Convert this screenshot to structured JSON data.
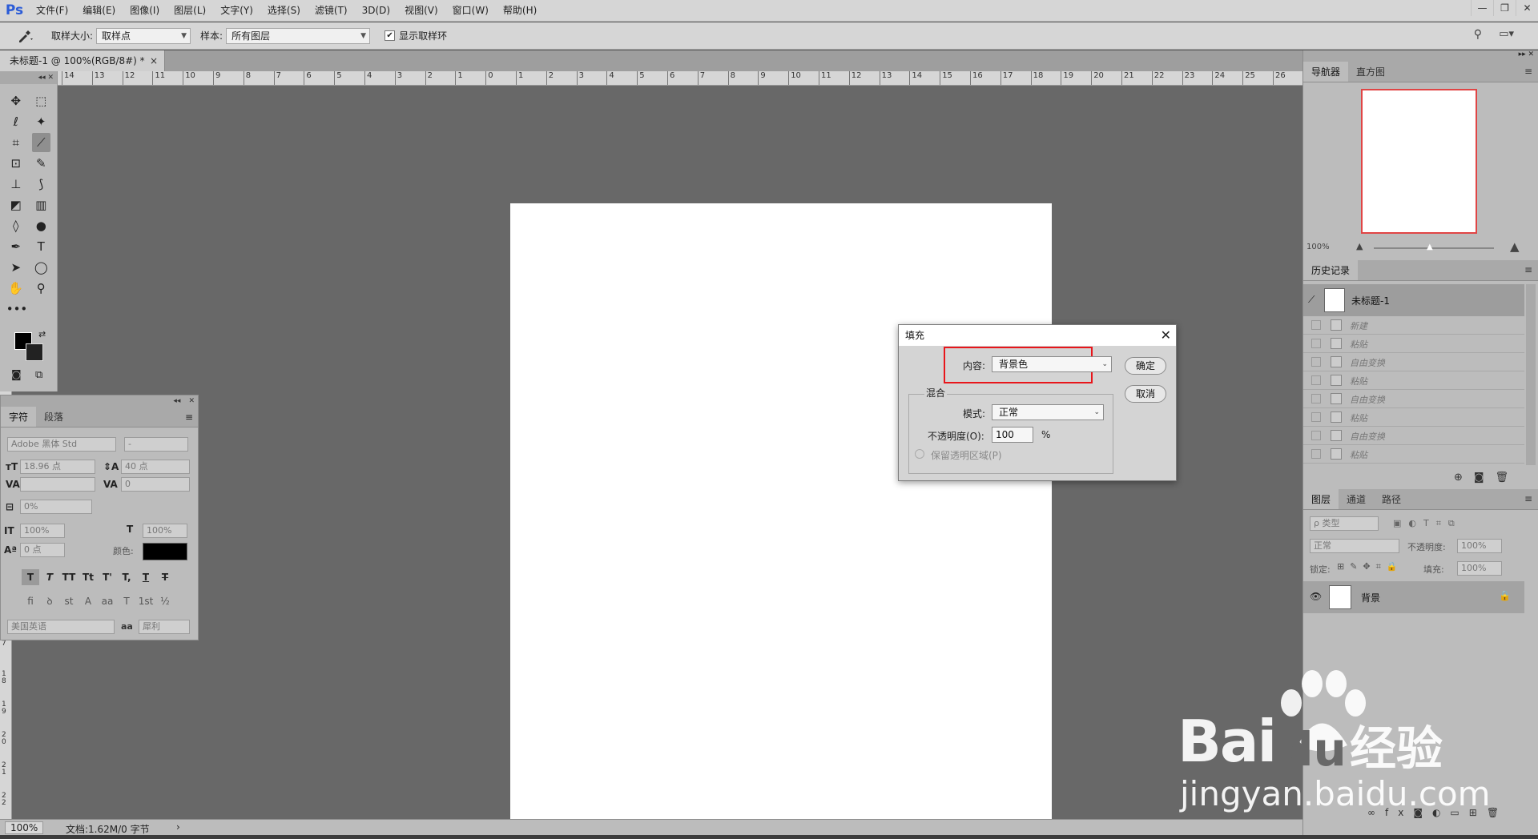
{
  "app": {
    "logo": "Ps",
    "menu": [
      "文件(F)",
      "编辑(E)",
      "图像(I)",
      "图层(L)",
      "文字(Y)",
      "选择(S)",
      "滤镜(T)",
      "3D(D)",
      "视图(V)",
      "窗口(W)",
      "帮助(H)"
    ],
    "window_controls": [
      "—",
      "❐",
      "✕"
    ]
  },
  "options_bar": {
    "sample_size_label": "取样大小:",
    "sample_size_value": "取样点",
    "sample_label": "样本:",
    "sample_value": "所有图层",
    "show_ring_label": "显示取样环",
    "show_ring_checked": true
  },
  "document_tab": {
    "title": "未标题-1 @ 100%(RGB/8#) *",
    "close": "×"
  },
  "ruler": {
    "h_ticks": [
      "14",
      "13",
      "12",
      "11",
      "10",
      "9",
      "8",
      "7",
      "6",
      "5",
      "4",
      "3",
      "2",
      "1",
      "0",
      "1",
      "2",
      "3",
      "4",
      "5",
      "6",
      "7",
      "8",
      "9",
      "10",
      "11",
      "12",
      "13",
      "14",
      "15",
      "16",
      "17",
      "18",
      "19",
      "20",
      "21",
      "22",
      "23",
      "24",
      "25",
      "26"
    ],
    "v_ticks": [
      "7",
      "1 8",
      "1 9",
      "2 0",
      "2 1",
      "2 2"
    ]
  },
  "character_panel": {
    "tabs": [
      "字符",
      "段落"
    ],
    "font_family": "Adobe 黑体 Std",
    "font_style": "-",
    "font_size": "18.96 点",
    "leading": "40 点",
    "kerning": "",
    "tracking": "0",
    "scale_pct": "0%",
    "vertical_scale": "100%",
    "horizontal_scale": "100%",
    "baseline_shift": "0 点",
    "color_label": "颜色:",
    "language": "美国英语",
    "aa_label": "aa",
    "antialias": "犀利",
    "style_buttons": [
      "T",
      "T",
      "TT",
      "Tt",
      "T'",
      "T,",
      "T",
      "T"
    ],
    "opentype_buttons": [
      "fi",
      "ꝺ",
      "st",
      "A",
      "aa",
      "T",
      "1st",
      "½"
    ]
  },
  "navigator": {
    "tabs": [
      "导航器",
      "直方图"
    ],
    "zoom": "100%"
  },
  "history": {
    "tab": "历史记录",
    "snapshot_label": "未标题-1",
    "items": [
      "新建",
      "粘贴",
      "自由变换",
      "粘贴",
      "自由变换",
      "粘贴",
      "自由变换",
      "粘贴"
    ]
  },
  "layers": {
    "tabs": [
      "图层",
      "通道",
      "路径"
    ],
    "filter_label": "ρ 类型",
    "blend_mode": "正常",
    "opacity_label": "不透明度:",
    "opacity_value": "100%",
    "lock_label": "锁定:",
    "fill_label": "填充:",
    "fill_value": "100%",
    "layer_name": "背景"
  },
  "status": {
    "zoom": "100%",
    "doc_info": "文档:1.62M/0 字节"
  },
  "fill_dialog": {
    "title": "填充",
    "content_label": "内容:",
    "content_value": "背景色",
    "blend_group": "混合",
    "mode_label": "模式:",
    "mode_value": "正常",
    "opacity_label": "不透明度(O):",
    "opacity_value": "100",
    "opacity_unit": "%",
    "preserve_label": "保留透明区域(P)",
    "ok": "确定",
    "cancel": "取消"
  },
  "watermark": {
    "brand_a": "Bai",
    "brand_b": "du",
    "brand_c": "经验",
    "url": "jingyan.baidu.com"
  }
}
